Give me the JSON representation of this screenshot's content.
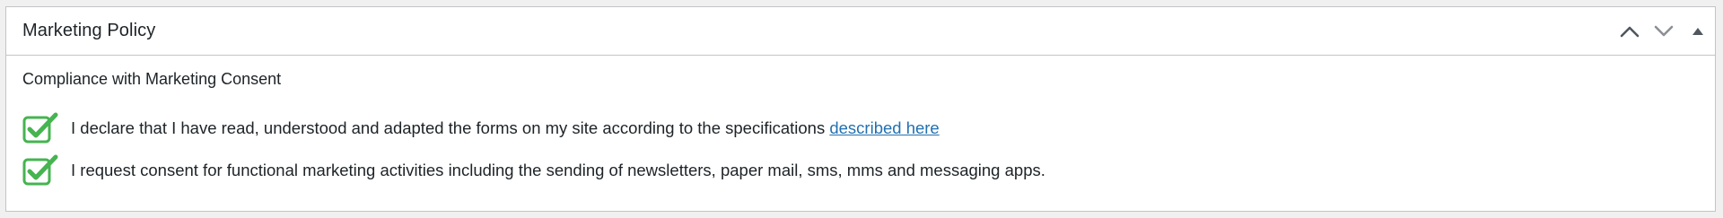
{
  "panel": {
    "title": "Marketing Policy",
    "controls": {
      "move_up_icon": "chevron-up-icon",
      "move_down_icon": "chevron-down-icon",
      "toggle_icon": "triangle-up-icon"
    }
  },
  "content": {
    "heading": "Compliance with Marketing Consent",
    "items": [
      {
        "checked": true,
        "text": "I declare that I have read, understood and adapted the forms on my site according to the specifications ",
        "link_text": "described here"
      },
      {
        "checked": true,
        "text": "I request consent for functional marketing activities including the sending of newsletters, paper mail, sms, mms and messaging apps."
      }
    ]
  },
  "colors": {
    "check_green": "#46b450",
    "link_blue": "#2271b1",
    "border": "#c3c4c7",
    "background": "#f0f0f1"
  }
}
